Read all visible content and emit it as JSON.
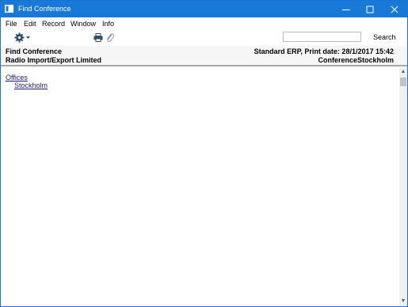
{
  "window": {
    "title": "Find Conference",
    "minimize_icon": "minimize-icon",
    "maximize_icon": "maximize-icon",
    "close_icon": "close-icon"
  },
  "menu": {
    "items": [
      "File",
      "Edit",
      "Record",
      "Window",
      "Info"
    ]
  },
  "toolbar": {
    "actions_icon": "gear-icon",
    "print_icon": "printer-icon",
    "attach_icon": "paperclip-icon",
    "search_placeholder": "",
    "search_label": "Search"
  },
  "header": {
    "report_title": "Find Conference",
    "company": "Radio Import/Export Limited",
    "print_info": "Standard ERP, Print date: 28/1/2017 15:42",
    "report_id": "ConferenceStockholm"
  },
  "content": {
    "group_label": "Offices",
    "items": [
      "Stockholm"
    ]
  }
}
